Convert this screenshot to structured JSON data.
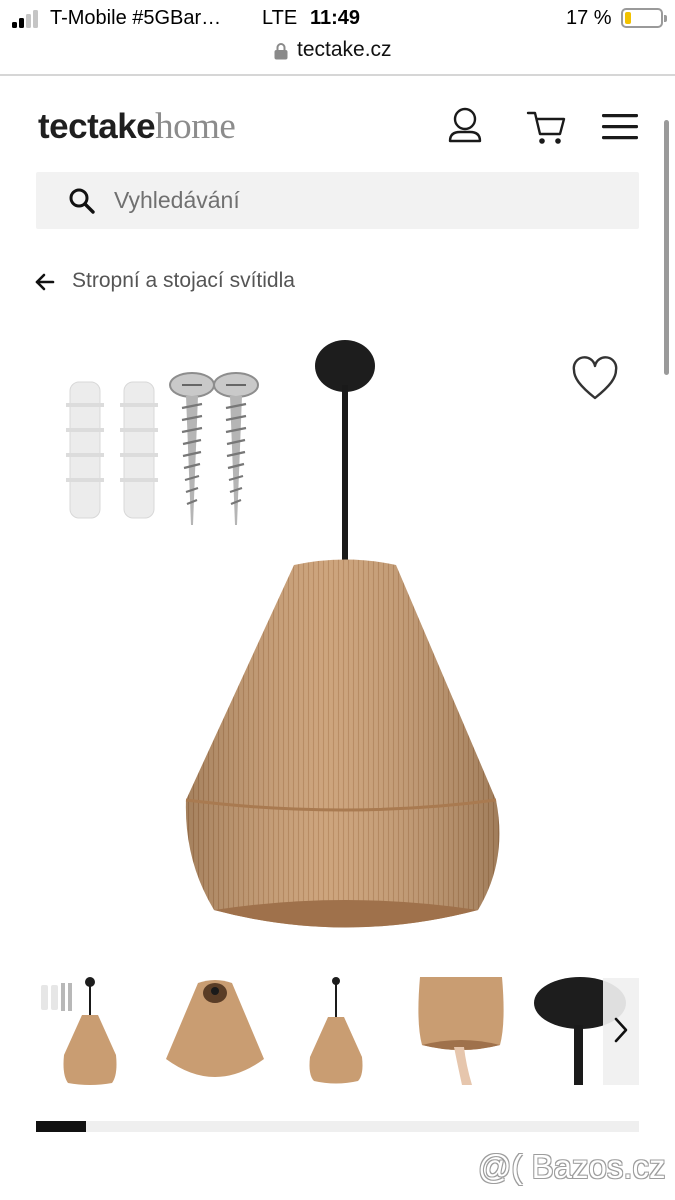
{
  "status_bar": {
    "carrier": "T-Mobile #5GBar…",
    "network": "LTE",
    "time": "11:49",
    "battery": "17 %",
    "battery_level_fraction": 0.17,
    "battery_color": "#f2c200"
  },
  "browser": {
    "url": "tectake.cz",
    "lock_icon": "lock-icon"
  },
  "header": {
    "logo_brand": "tectake",
    "logo_sub": "home",
    "icons": [
      "user-icon",
      "cart-icon",
      "menu-icon"
    ]
  },
  "search": {
    "placeholder": "Vyhledávání",
    "value": ""
  },
  "breadcrumb": {
    "label": "Stropní a stojací svítidla"
  },
  "gallery": {
    "thumbnail_count_visible": 5,
    "progress_fraction": 0.083
  },
  "colors": {
    "search_background": "#f2f2f2",
    "jute": "#c79a6e",
    "progress_fill": "#111111"
  },
  "watermark": "@( Bazos.cz"
}
